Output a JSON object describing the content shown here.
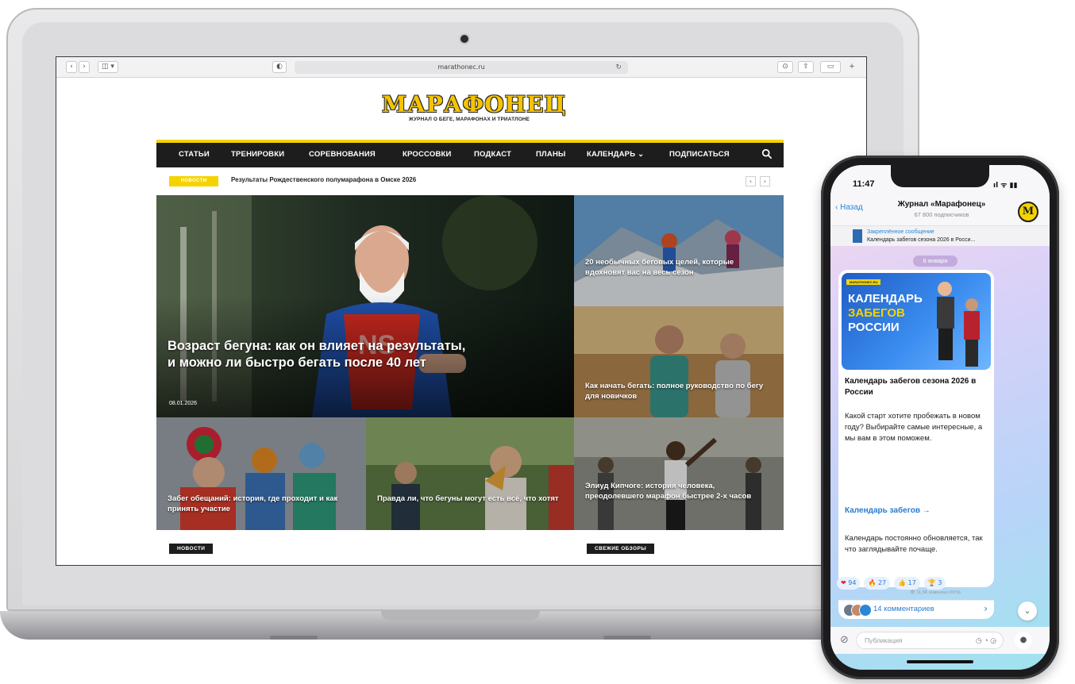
{
  "browser": {
    "url": "marathonec.ru"
  },
  "site": {
    "logo": "МАРАФОНЕЦ",
    "tagline": "ЖУРНАЛ О БЕГЕ, МАРАФОНАХ И ТРИАТЛОНЕ",
    "nav": [
      "СТАТЬИ",
      "ТРЕНИРОВКИ",
      "СОРЕВНОВАНИЯ",
      "КРОССОВКИ",
      "ПОДКАСТ",
      "ПЛАНЫ",
      "КАЛЕНДАРЬ ⌄",
      "ПОДПИСАТЬСЯ"
    ],
    "ticker": {
      "badge": "НОВОСТИ",
      "text": "Результаты Рождественского полумарафона в Омске 2026"
    },
    "hero": {
      "title": "Возраст бегуна: как он влияет на результаты, и можно ли быстро бегать после 40 лет",
      "date": "08.01.2026"
    },
    "tiles": [
      {
        "title": "20 необычных беговых целей, которые вдохновят вас на весь сезон"
      },
      {
        "title": "Как начать бегать: полное руководство по бегу для новичков"
      },
      {
        "title": "Забег обещаний: история, где проходит и как принять участие"
      },
      {
        "title": "Правда ли, что бегуны могут есть всё, что хотят"
      },
      {
        "title": "Элиуд Кипчоге: история человека, преодолевшего марафон быстрее 2-х часов"
      }
    ],
    "sections": {
      "left": "НОВОСТИ",
      "right": "СВЕЖИЕ ОБЗОРЫ"
    },
    "colors": {
      "brand_yellow": "#f5d300",
      "nav_dark": "#1d1d1d"
    }
  },
  "phone": {
    "time": "11:47",
    "status_right": "ıl ᯤ ▮▮",
    "back": "‹ Назад",
    "channel_title": "Журнал «Марафонец»",
    "channel_sub": "67 800 подписчиков",
    "avatar_letter": "M",
    "pinned": {
      "label": "Закреплённое сообщение",
      "text": "Календарь забегов сезона 2026 в Росси..."
    },
    "date_pill": "6 января",
    "post": {
      "image": {
        "badge": "MARATHONEC.RU",
        "line1": "КАЛЕНДАРЬ",
        "line2": "ЗАБЕГОВ",
        "line3": "РОССИИ"
      },
      "title": "Календарь забегов сезона 2026 в России",
      "para1": "Какой старт хотите пробежать в новом году? Выбирайте самые интересные, а мы вам в этом поможем.",
      "link": "Календарь забегов →",
      "para2": "Календарь постоянно обновляется, так что заглядывайте почаще.",
      "reactions": [
        {
          "emoji": "❤",
          "count": "94"
        },
        {
          "emoji": "🔥",
          "count": "27"
        },
        {
          "emoji": "👍",
          "count": "17"
        },
        {
          "emoji": "🏆",
          "count": "3"
        }
      ],
      "meta": "👁 11,5K  изменено 09:56",
      "comments": "14 комментариев"
    },
    "input_placeholder": "Публикация"
  }
}
